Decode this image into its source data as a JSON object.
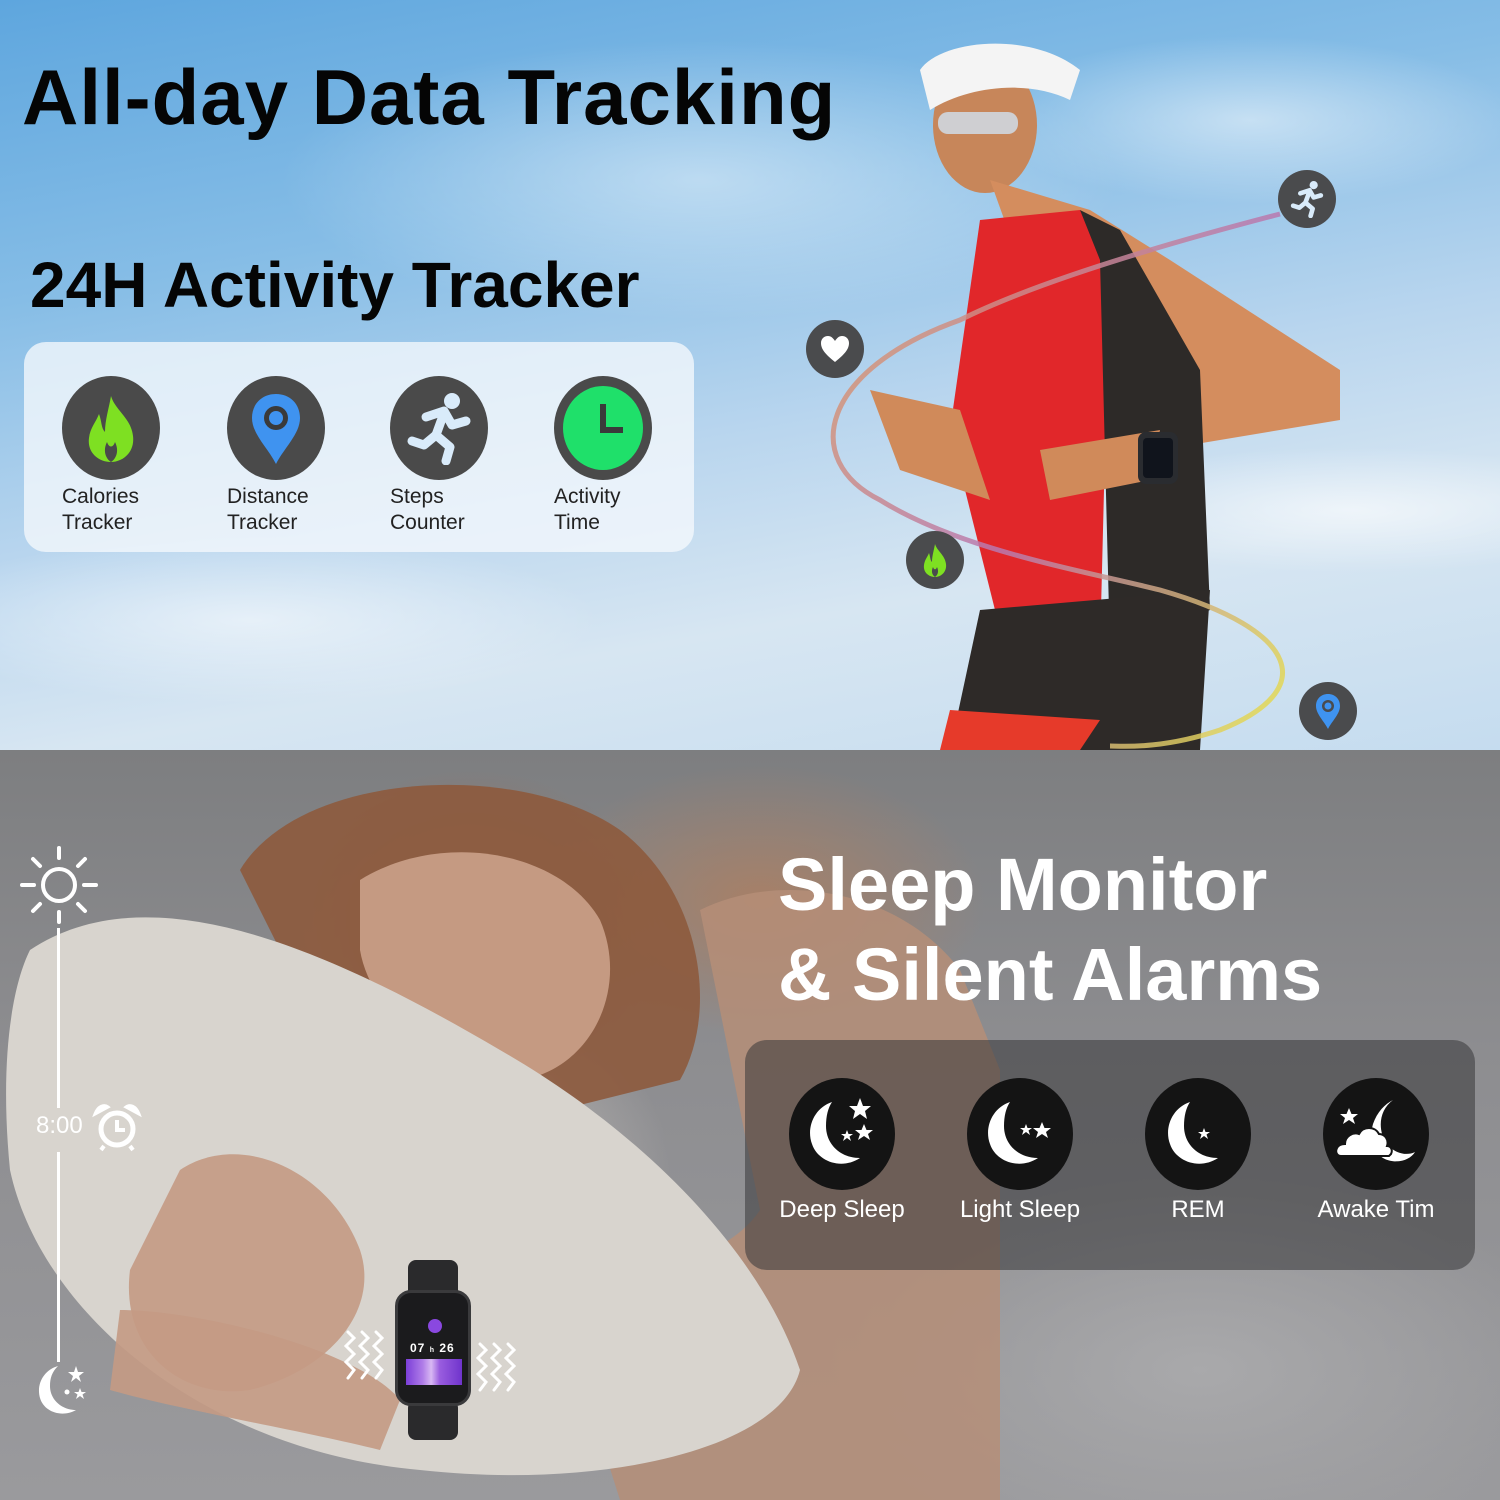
{
  "top_panel": {
    "title": "All-day Data Tracking",
    "subtitle": "24H Activity Tracker",
    "features": [
      {
        "icon": "flame-icon",
        "line1": "Calories",
        "line2": "Tracker",
        "color": "#7ee022"
      },
      {
        "icon": "location-pin-icon",
        "line1": "Distance",
        "line2": "Tracker",
        "color": "#3f93f0"
      },
      {
        "icon": "running-person-icon",
        "line1": "Steps",
        "line2": "Counter",
        "color": "#d9ebfa"
      },
      {
        "icon": "clock-icon",
        "line1": "Activity",
        "line2": "Time",
        "color": "#1fe06a"
      }
    ],
    "floating_icons": [
      "running-person-icon",
      "heart-icon",
      "flame-icon",
      "location-pin-icon"
    ]
  },
  "bottom_panel": {
    "title_line1": "Sleep Monitor",
    "title_line2": "& Silent Alarms",
    "features": [
      {
        "icon": "moon-three-stars-icon",
        "label": "Deep Sleep"
      },
      {
        "icon": "moon-two-stars-icon",
        "label": "Light Sleep"
      },
      {
        "icon": "moon-one-star-icon",
        "label": "REM"
      },
      {
        "icon": "moon-cloud-icon",
        "label": "Awake Tim"
      }
    ],
    "timeline": {
      "top_icon": "sun-icon",
      "alarm_time": "8:00",
      "alarm_icon": "alarm-clock-icon",
      "bottom_icon": "moon-stars-icon"
    },
    "watch": {
      "hours": "07",
      "minutes": "26",
      "vibration_icon": "vibration-zigzag-icon"
    }
  }
}
